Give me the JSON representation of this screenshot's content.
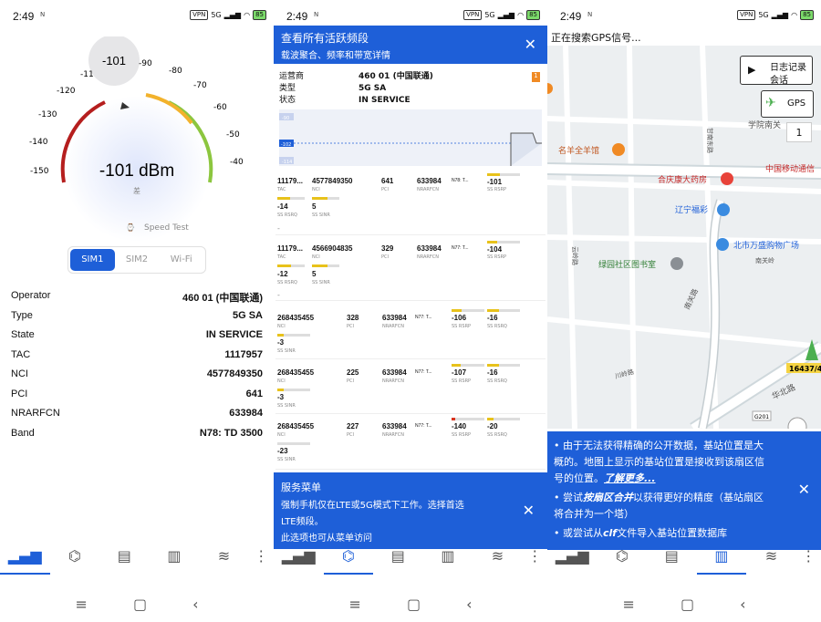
{
  "status": {
    "time": "2:49",
    "n": "N",
    "vpn": "VPN",
    "net": "5G",
    "battery": "85"
  },
  "p1": {
    "gauge_reading": "-101",
    "gauge_value": "-101 dBm",
    "quality": "差",
    "ticks": [
      "-150",
      "-140",
      "-130",
      "-120",
      "-11",
      "-90",
      "-80",
      "-70",
      "-60",
      "-50",
      "-40"
    ],
    "speed_test": "Speed Test",
    "tabs": [
      "SIM1",
      "SIM2",
      "Wi-Fi"
    ],
    "rows": [
      {
        "k": "Operator",
        "v": "460 01 (中国联通)"
      },
      {
        "k": "Type",
        "v": "5G SA"
      },
      {
        "k": "State",
        "v": "IN SERVICE"
      },
      {
        "k": "TAC",
        "v": "1117957"
      },
      {
        "k": "NCI",
        "v": "4577849350"
      },
      {
        "k": "PCI",
        "v": "641"
      },
      {
        "k": "NRARFCN",
        "v": "633984"
      },
      {
        "k": "Band",
        "v": "N78: TD 3500"
      }
    ]
  },
  "p2": {
    "banner_title": "查看所有活跃频段",
    "banner_sub": "载波聚合、频率和带宽详情",
    "info": [
      {
        "k": "运营商",
        "v": "460 01 (中国联通)"
      },
      {
        "k": "类型",
        "v": "5G SA"
      },
      {
        "k": "状态",
        "v": "IN SERVICE"
      }
    ],
    "badge": "1",
    "chart_label_top": "-90",
    "chart_label_mid": "-102",
    "chart_label_bot": "-114",
    "cells": [
      {
        "tac": "11179...",
        "nci": "4577849350",
        "pci": "641",
        "arfcn": "633984",
        "band": "N78: T...",
        "rsrp": "-101",
        "rsrq": "-14",
        "sinr": "5",
        "dash": "-"
      },
      {
        "tac": "11179...",
        "nci": "4566904835",
        "pci": "329",
        "arfcn": "633984",
        "band": "N77: T...",
        "rsrp": "-104",
        "rsrq": "-12",
        "sinr": "5",
        "dash": "-"
      },
      {
        "nci": "268435455",
        "pci": "328",
        "arfcn": "633984",
        "band": "N77: T...",
        "rsrp": "-106",
        "rsrq": "-16",
        "sinr": "-3"
      },
      {
        "nci": "268435455",
        "pci": "225",
        "arfcn": "633984",
        "band": "N77: T...",
        "rsrp": "-107",
        "rsrq": "-16",
        "sinr": "-3"
      },
      {
        "nci": "268435455",
        "pci": "227",
        "arfcn": "633984",
        "band": "N77: T...",
        "rsrp": "-140",
        "rsrq": "-20",
        "sinr": "-23"
      }
    ],
    "labels": {
      "tac": "TAC",
      "nci": "NCI",
      "pci": "PCI",
      "arfcn": "NRARFCN",
      "rsrp": "SS RSRP",
      "rsrq": "SS RSRQ",
      "sinr": "SS SINR"
    },
    "menu_title": "服务菜单",
    "menu_l1": "强制手机仅在LTE或5G模式下工作。选择首选",
    "menu_l2": "LTE频段。",
    "menu_l3": "此选项也可从菜单访问"
  },
  "p3": {
    "gps_search": "正在搜索GPS信号...",
    "log_btn_l1": "日志记录",
    "log_btn_l2": "会话",
    "gps_btn": "GPS",
    "count": "1",
    "tower_label": "16437/4",
    "places": [
      "学院南关",
      "名羊全羊馆",
      "合庆康大药房",
      "中国移动通信",
      "辽宁福彩",
      "北市万盛购物广场",
      "南关岭",
      "绿园社区图书室",
      "云岭路",
      "南关路",
      "甘南东路",
      "川岭路",
      "华北路",
      "G201"
    ],
    "info1": "• 由于无法获得精确的公开数据，基站位置是大",
    "info2": "概的。地图上显示的基站位置是接收到该扇区信",
    "info3": "号的位置。",
    "info3b": "了解更多...",
    "info4a": "• 尝试",
    "info4b": "按扇区合并",
    "info4c": "以获得更好的精度（基站扇区",
    "info5": "将合并为一个塔）",
    "info6a": "• 或尝试从",
    "info6b": "clf",
    "info6c": "文件导入基站位置数据库"
  },
  "nav": [
    "signal-bars-icon",
    "antenna-icon",
    "clipboard-icon",
    "map-icon",
    "wifi-icon",
    "more-icon"
  ]
}
